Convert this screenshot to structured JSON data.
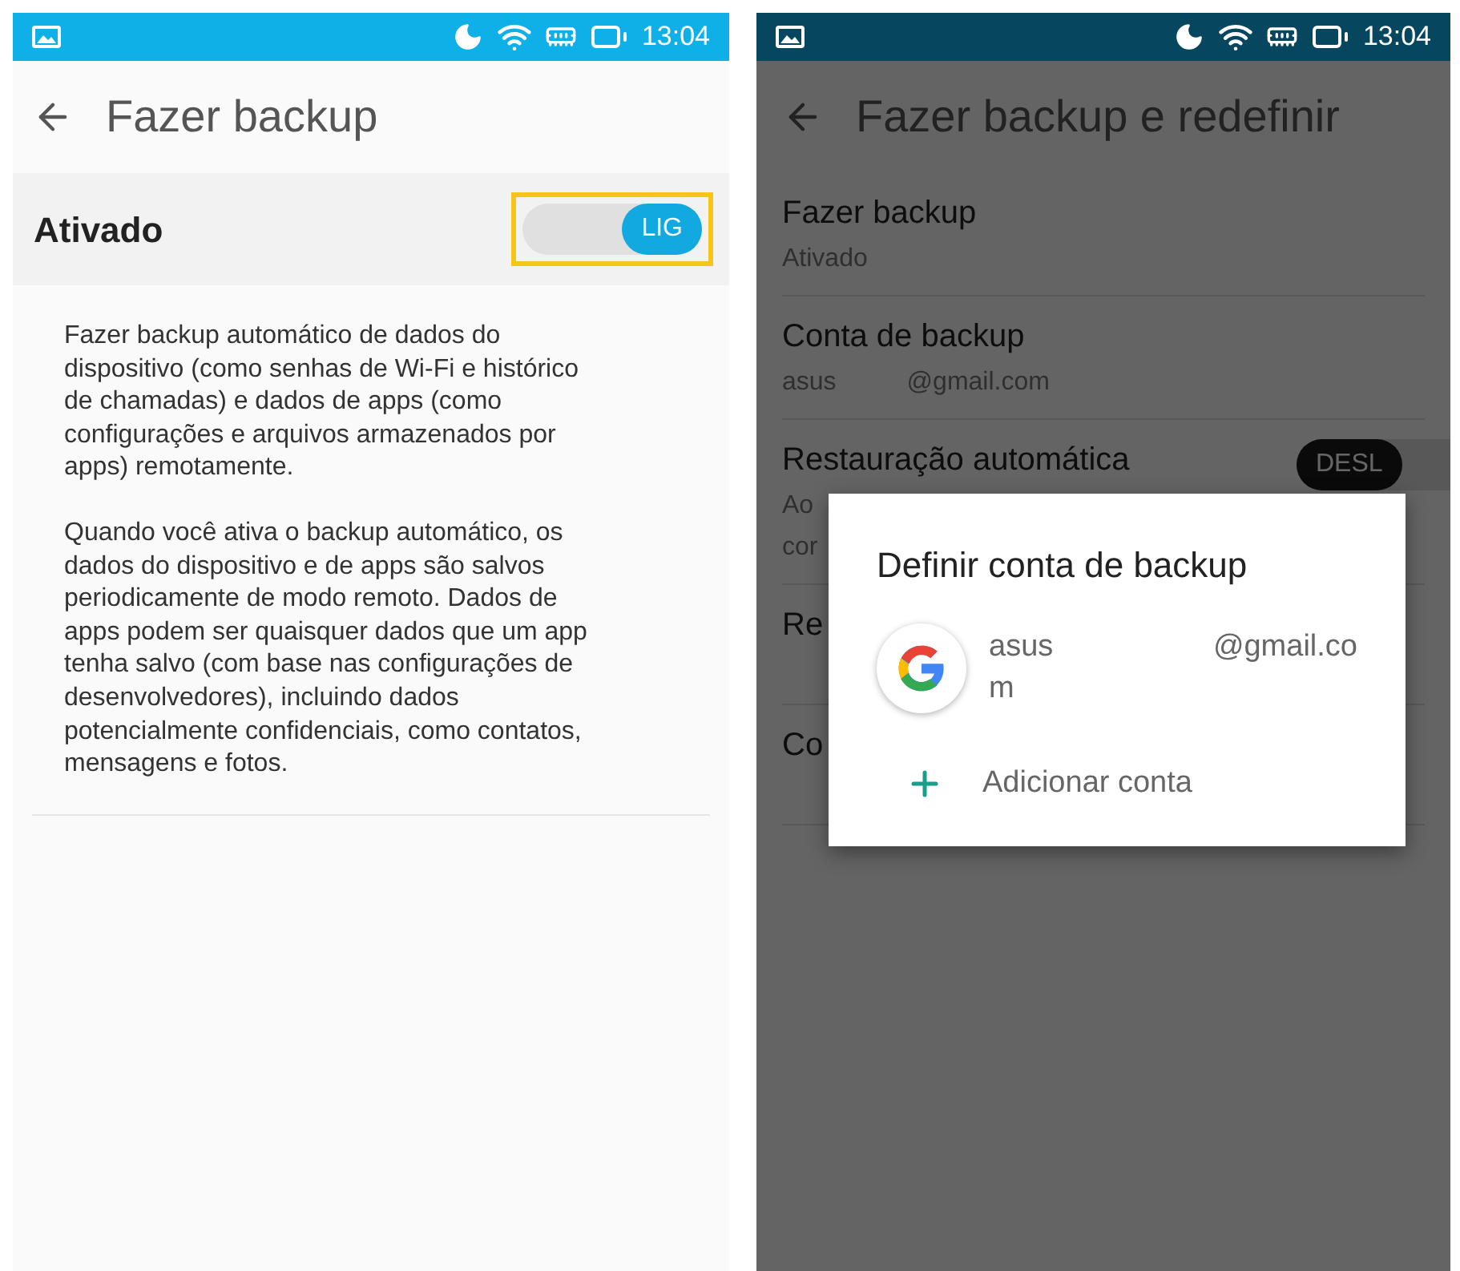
{
  "left_screen": {
    "status_bar": {
      "time": "13:04"
    },
    "title": "Fazer backup",
    "toggle_row": {
      "label": "Ativado",
      "toggle": {
        "on": true,
        "label": "LIG",
        "highlighted": true
      }
    },
    "description": [
      "Fazer backup automático de dados do dispositivo (como senhas de Wi-Fi e histórico de chamadas) e dados de apps (como configurações e arquivos armazenados por apps) remotamente.",
      "Quando você ativa o backup automático, os dados do dispositivo e de apps são salvos periodicamente de modo remoto. Dados de apps podem ser quaisquer dados que um app tenha salvo (com base nas configurações de desenvolvedores), incluindo dados potencialmente confidenciais, como contatos, mensagens e fotos."
    ]
  },
  "right_screen": {
    "dimmed": true,
    "status_bar": {
      "time": "13:04"
    },
    "title": "Fazer backup e redefinir",
    "items": [
      {
        "kind": "summary",
        "title": "Fazer backup",
        "summary": "Ativado"
      },
      {
        "kind": "account",
        "title": "Conta de backup",
        "account_name": "asus",
        "account_domain": "@gmail.com"
      },
      {
        "kind": "toggle",
        "title": "Restauração automática",
        "summary_lines": [
          "Ao",
          "cor"
        ],
        "toggle": {
          "on": false,
          "label": "DESL"
        }
      },
      {
        "kind": "plain",
        "title": "Re"
      },
      {
        "kind": "plain",
        "title": "Co"
      }
    ],
    "dialog": {
      "title": "Definir conta de backup",
      "accounts": [
        {
          "name": "asus",
          "domain": "@gmail.co",
          "domain_rest": "m"
        }
      ],
      "add_label": "Adicionar conta"
    }
  }
}
